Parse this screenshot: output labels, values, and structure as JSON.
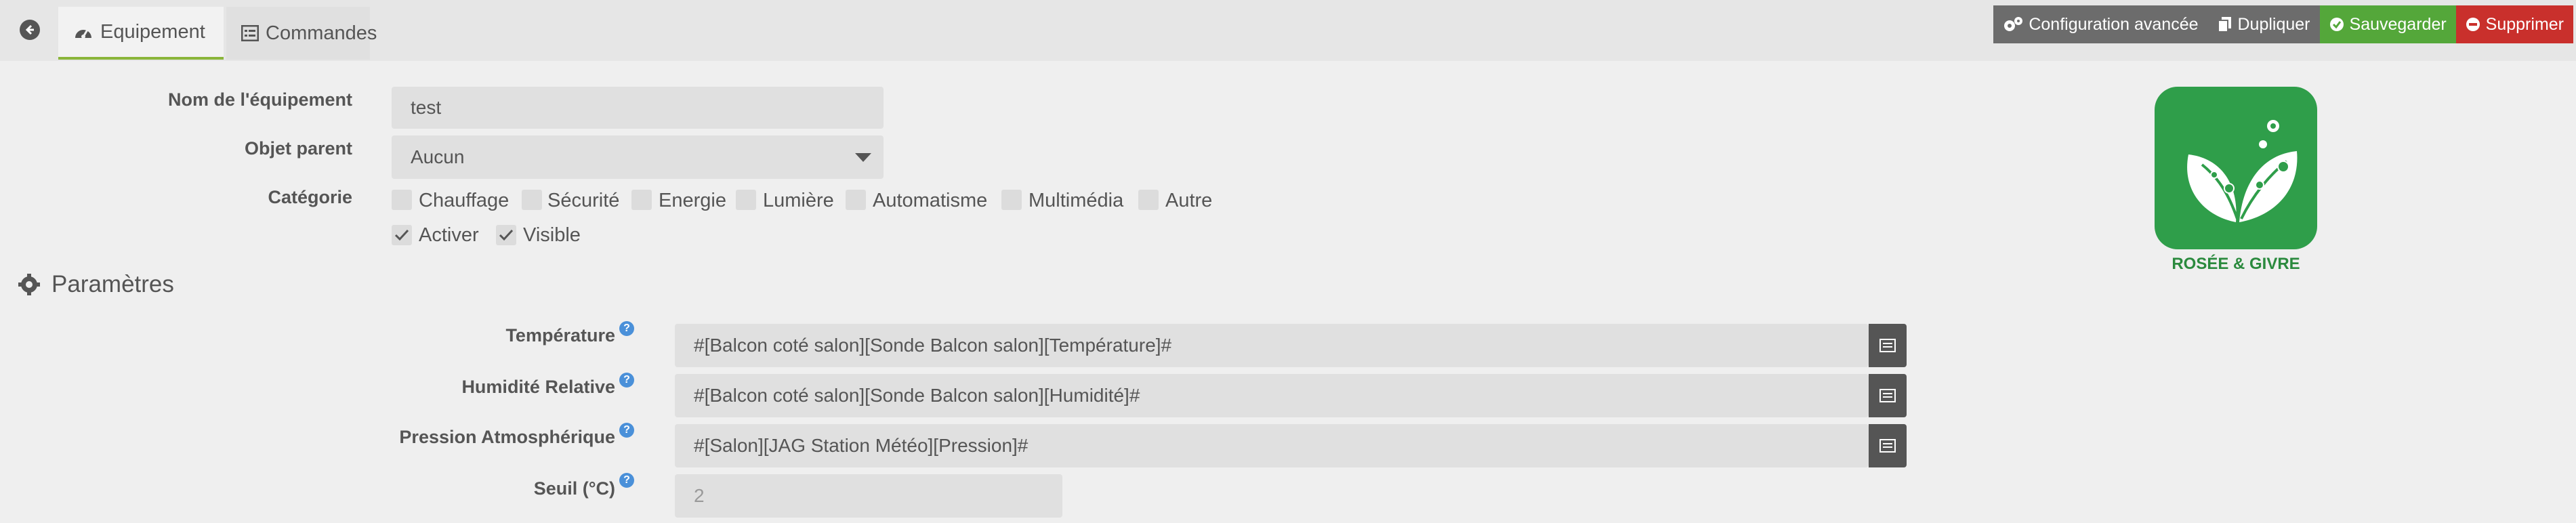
{
  "tabs": [
    {
      "label": "Equipement",
      "icon": "tachometer-icon"
    },
    {
      "label": "Commandes",
      "icon": "list-icon"
    }
  ],
  "actions": [
    {
      "label": "Configuration avancée",
      "icon": "cogs-icon",
      "color": "#6c6c6c"
    },
    {
      "label": "Dupliquer",
      "icon": "copy-icon",
      "color": "#6c6c6c"
    },
    {
      "label": "Sauvegarder",
      "icon": "check-circle-icon",
      "color": "#54a73a"
    },
    {
      "label": "Supprimer",
      "icon": "minus-circle-icon",
      "color": "#c9302c"
    }
  ],
  "equipment": {
    "name_label": "Nom de l'équipement",
    "name_value": "test",
    "parent_label": "Objet parent",
    "parent_value": "Aucun",
    "category_label": "Catégorie",
    "categories": [
      "Chauffage",
      "Sécurité",
      "Energie",
      "Lumière",
      "Automatisme",
      "Multimédia",
      "Autre"
    ],
    "activate_label": "Activer",
    "visible_label": "Visible"
  },
  "params": {
    "title": "Paramètres",
    "temperature_label": "Température",
    "temperature_value": "#[Balcon coté salon][Sonde Balcon salon][Température]#",
    "humidity_label": "Humidité Relative",
    "humidity_value": "#[Balcon coté salon][Sonde Balcon salon][Humidité]#",
    "pressure_label": "Pression Atmosphérique",
    "pressure_value": "#[Salon][JAG Station Météo][Pression]#",
    "threshold_label": "Seuil (°C)",
    "threshold_value": "2",
    "help_glyph": "?"
  },
  "logo": {
    "caption": "ROSÉE & GIVRE",
    "color": "#2f9e4a"
  }
}
